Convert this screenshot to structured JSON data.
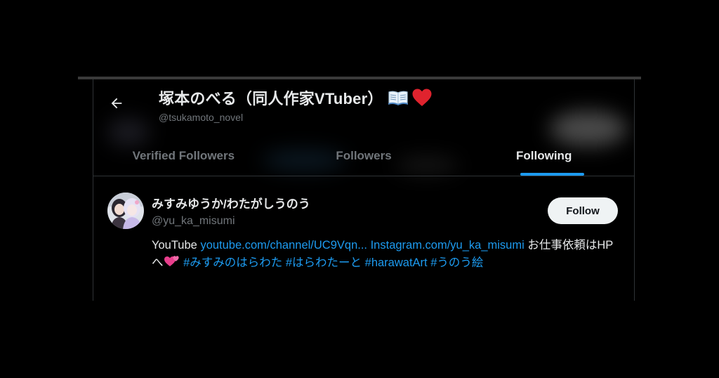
{
  "header": {
    "back_icon": "arrow-left-icon",
    "profile_name": "塚本のべる（同人作家VTuber）",
    "profile_name_emojis": [
      "open-book-icon",
      "red-heart-icon"
    ],
    "profile_handle": "@tsukamoto_novel"
  },
  "tabs": [
    {
      "label": "Verified Followers",
      "active": false
    },
    {
      "label": "Followers",
      "active": false
    },
    {
      "label": "Following",
      "active": true
    }
  ],
  "user": {
    "avatar_icon": "avatar-icon",
    "name": "みすみゆうか/わたがしうのう",
    "handle": "@yu_ka_misumi",
    "follow_label": "Follow",
    "bio": {
      "text_1": "YouTube ",
      "link_youtube": "youtube.com/channel/UC9Vqn...",
      "space_1": " ",
      "link_instagram": "Instagram.com/yu_ka_misumi",
      "text_2": " お仕事依頼はHPへ",
      "emoji": "two-hearts-icon",
      "space_2": " ",
      "hashtag_1": "#みすみのはらわた",
      "hashtag_2": "#はらわたーと",
      "hashtag_3": "#harawatArt",
      "hashtag_4": "#うのう絵"
    }
  },
  "colors": {
    "background": "#000000",
    "text_primary": "#e7e9ea",
    "text_secondary": "#71767b",
    "accent": "#1d9bf0",
    "border": "#2f3336",
    "follow_button_bg": "#eff3f4"
  }
}
